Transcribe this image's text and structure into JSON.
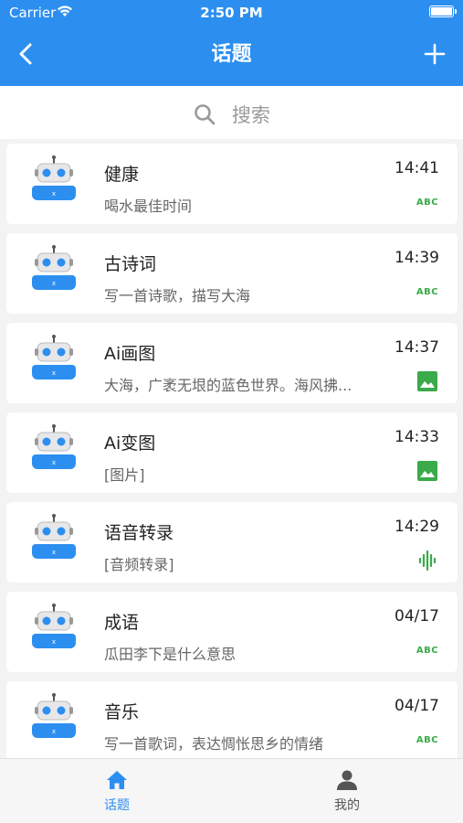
{
  "status": {
    "carrier": "Carrier",
    "time": "2:50 PM"
  },
  "nav": {
    "title": "话题"
  },
  "search": {
    "placeholder": "搜索"
  },
  "items": [
    {
      "title": "健康",
      "preview": "喝水最佳时间",
      "time": "14:41",
      "type_label": "ABC"
    },
    {
      "title": "古诗词",
      "preview": "写一首诗歌，描写大海",
      "time": "14:39",
      "type_label": "ABC"
    },
    {
      "title": "Ai画图",
      "preview": "大海，广袤无垠的蓝色世界。海风拂...",
      "time": "14:37",
      "type_label": "image-icon"
    },
    {
      "title": "Ai变图",
      "preview": "[图片]",
      "time": "14:33",
      "type_label": "image-icon"
    },
    {
      "title": "语音转录",
      "preview": "[音频转录]",
      "time": "14:29",
      "type_label": "audio-icon"
    },
    {
      "title": "成语",
      "preview": "瓜田李下是什么意思",
      "time": "04/17",
      "type_label": "ABC"
    },
    {
      "title": "音乐",
      "preview": "写一首歌词，表达惆怅思乡的情绪",
      "time": "04/17",
      "type_label": "ABC"
    }
  ],
  "tabbar": {
    "home_label": "话题",
    "me_label": "我的"
  },
  "colors": {
    "primary": "#2c8ff0",
    "type_green": "#3aaa4a"
  }
}
